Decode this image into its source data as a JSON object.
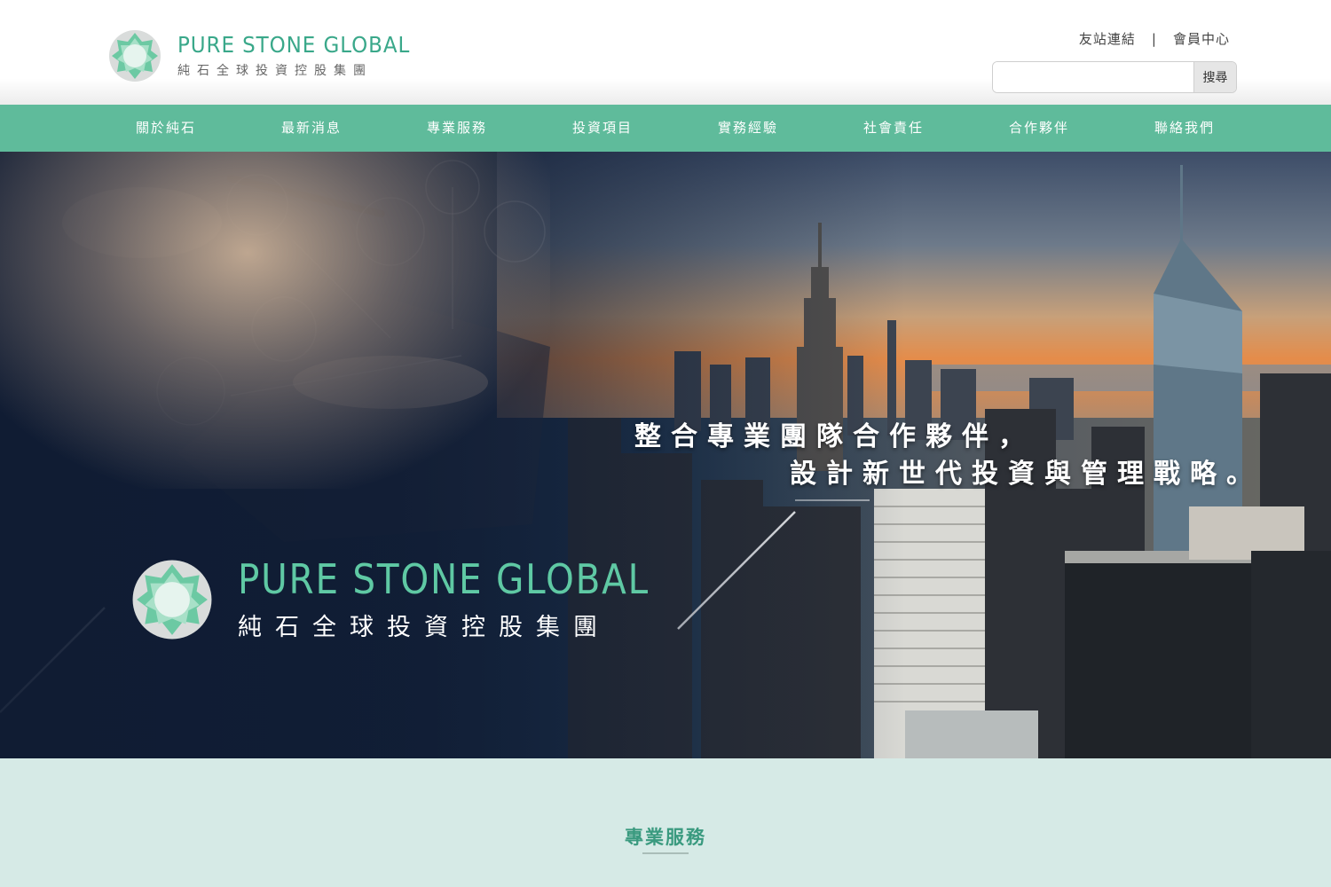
{
  "header": {
    "logo_en": "PURE STONE GLOBAL",
    "logo_zh": "純石全球投資控股集團",
    "top_links": [
      "友站連結",
      "會員中心"
    ],
    "separator": "|",
    "search": {
      "value": "",
      "placeholder": "",
      "button_label": "搜尋"
    }
  },
  "nav": {
    "items": [
      "關於純石",
      "最新消息",
      "專業服務",
      "投資項目",
      "實務經驗",
      "社會責任",
      "合作夥伴",
      "聯絡我們"
    ]
  },
  "hero": {
    "slogan_line1": "整合專業團隊合作夥伴，",
    "slogan_line2": "設計新世代投資與管理戰略。",
    "logo_en": "PURE STONE GLOBAL",
    "logo_zh": "純石全球投資控股集團"
  },
  "services": {
    "title": "專業服務"
  },
  "colors": {
    "brand_green": "#5fbb9b",
    "logo_text_green": "#3aa88a",
    "hero_logo_green": "#5fc9a4",
    "section_bg": "#d6eae6"
  },
  "icons": [
    "logo-gem-icon",
    "hero-logo-gem-icon"
  ]
}
